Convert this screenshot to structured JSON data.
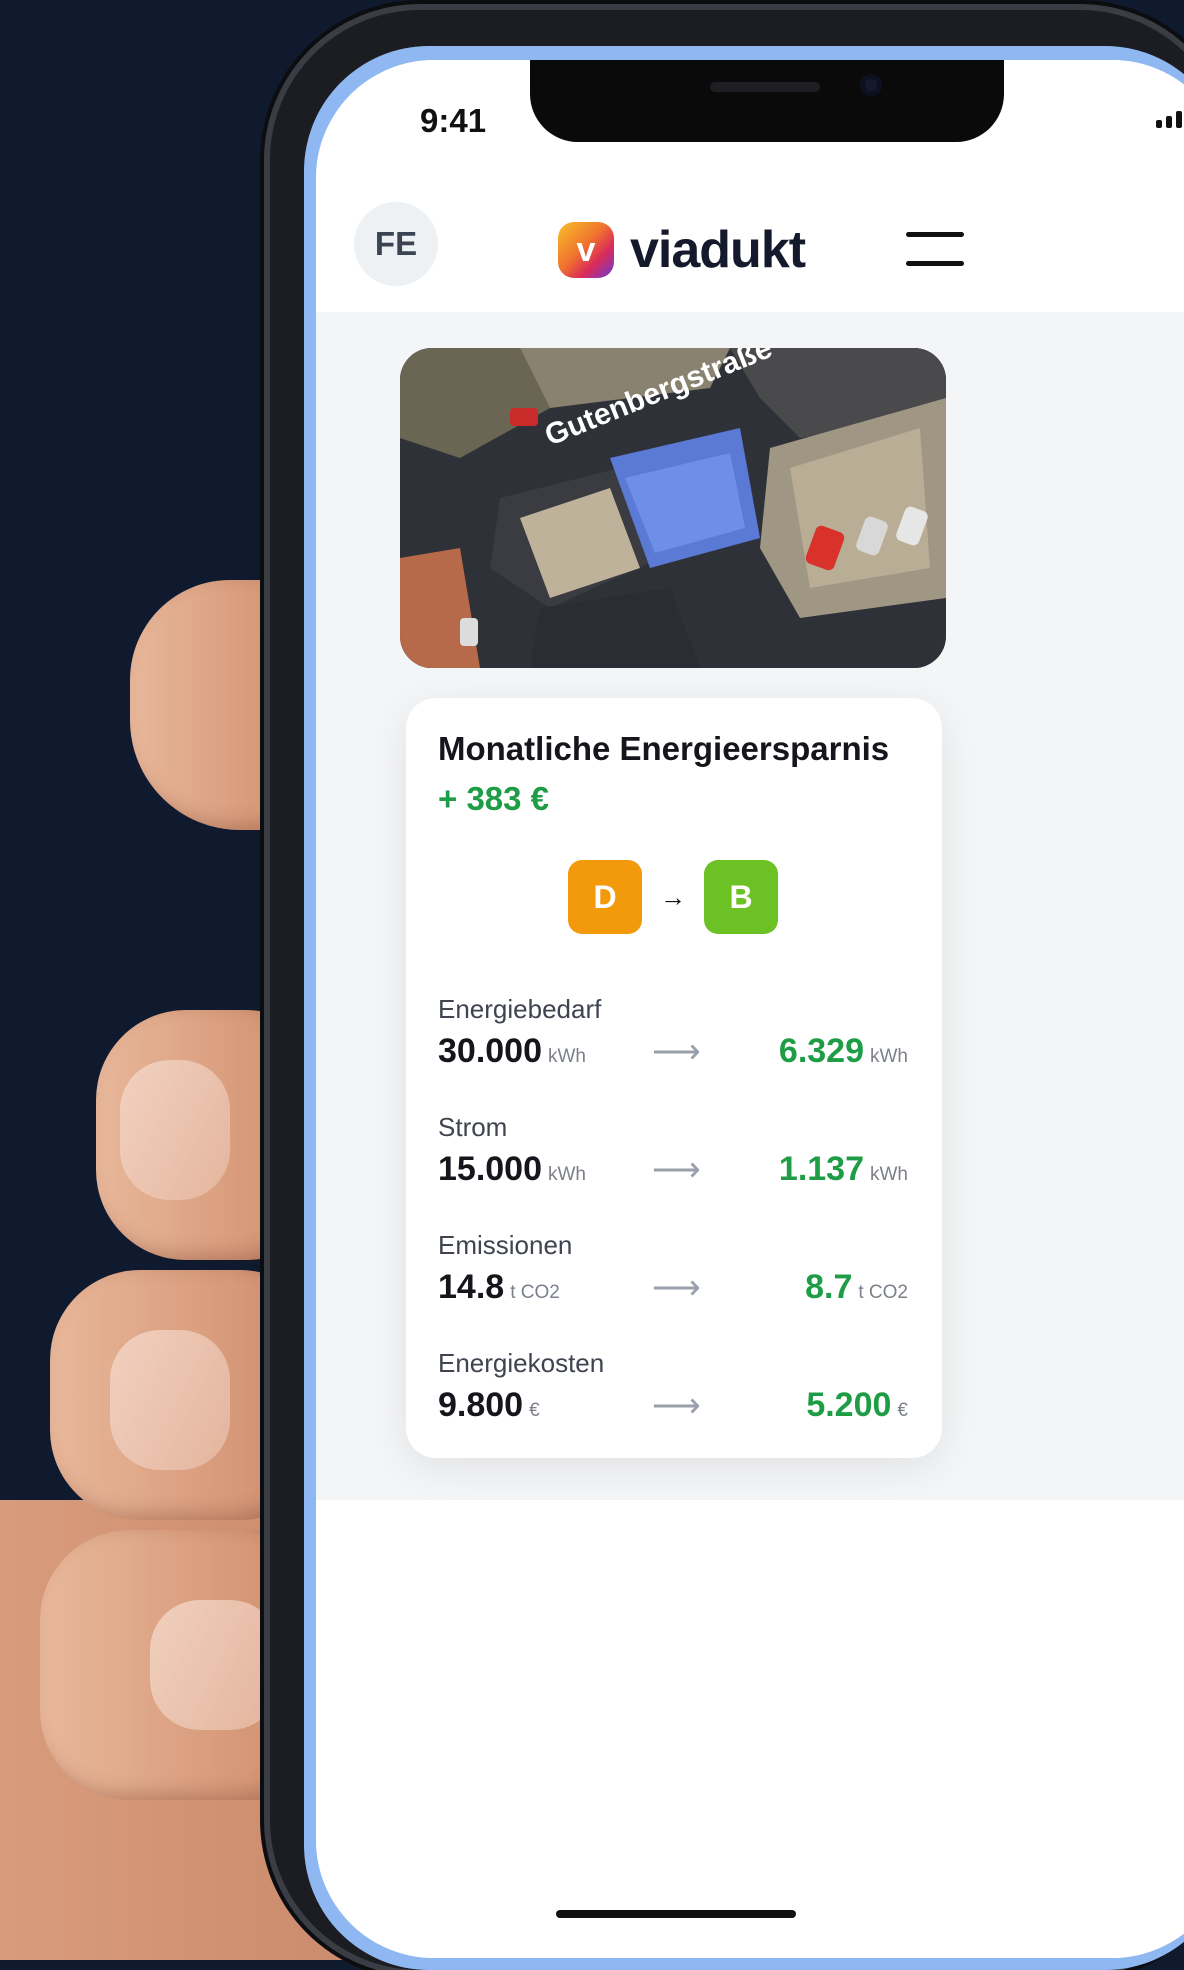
{
  "status_bar": {
    "time": "9:41"
  },
  "header": {
    "avatar_initials": "FE",
    "logo_letter": "v",
    "brand": "viadukt",
    "menu_icon": "hamburger-menu-icon"
  },
  "map": {
    "street_label": "Gutenbergstraße"
  },
  "card": {
    "title": "Monatliche Energieersparnis",
    "saving": "+ 383 €",
    "rating_from": "D",
    "rating_to": "B",
    "rating_arrow": "→",
    "rows": [
      {
        "label": "Energiebedarf",
        "old_value": "30.000",
        "old_unit": "kWh",
        "arrow": "⟶",
        "new_value": "6.329",
        "new_unit": "kWh"
      },
      {
        "label": "Strom",
        "old_value": "15.000",
        "old_unit": "kWh",
        "arrow": "⟶",
        "new_value": "1.137",
        "new_unit": "kWh"
      },
      {
        "label": "Emissionen",
        "old_value": "14.8",
        "old_unit": "t CO2",
        "arrow": "⟶",
        "new_value": "8.7",
        "new_unit": "t CO2"
      },
      {
        "label": "Energiekosten",
        "old_value": "9.800",
        "old_unit": "€",
        "arrow": "⟶",
        "new_value": "5.200",
        "new_unit": "€"
      }
    ]
  },
  "colors": {
    "background": "#0f1a2e",
    "accent_green": "#1f9d46",
    "rating_from": "#f29a0c",
    "rating_to": "#6cc225",
    "screen_border": "#8fb8f2"
  }
}
